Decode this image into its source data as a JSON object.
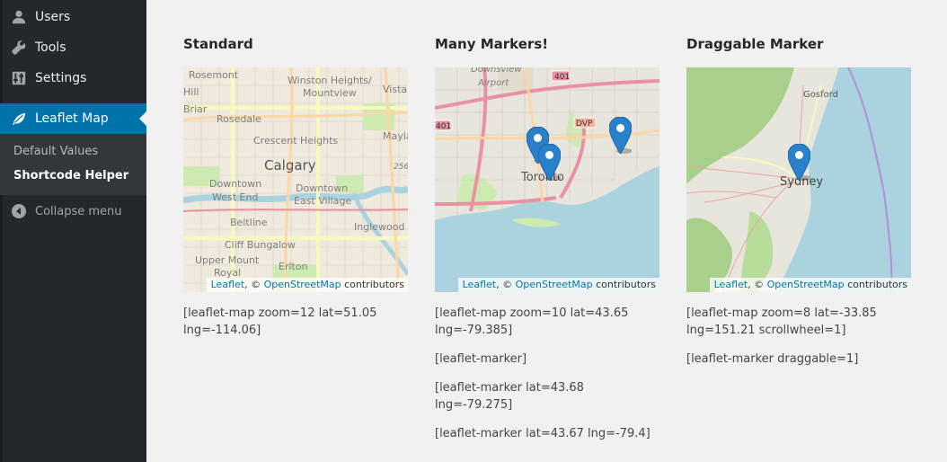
{
  "sidebar": {
    "items": [
      {
        "label": "Users",
        "icon": "users-icon"
      },
      {
        "label": "Tools",
        "icon": "wrench-icon"
      },
      {
        "label": "Settings",
        "icon": "settings-sliders-icon"
      },
      {
        "label": "Leaflet Map",
        "icon": "leaf-icon",
        "active": true
      }
    ],
    "submenu": [
      {
        "label": "Default Values"
      },
      {
        "label": "Shortcode Helper",
        "current": true
      }
    ],
    "collapse_label": "Collapse menu",
    "colors": {
      "background": "#23282d",
      "active": "#0073aa",
      "submenu": "#32373c"
    }
  },
  "attribution": {
    "leaflet": "Leaflet",
    "sep": ", © ",
    "osm": "OpenStreetMap",
    "suffix": " contributors"
  },
  "maps": [
    {
      "title": "Standard",
      "labels": [
        "Rosemont",
        "Winston Heights/",
        "Mountview",
        "Vista",
        "Hill",
        "Briar",
        "Rosedale",
        "Mayla",
        "Crescent Heights",
        "Calgary",
        "Downtown",
        "West End",
        "Downtown",
        "East Village",
        "Beltline",
        "Inglewood",
        "Cliff Bungalow",
        "Upper Mount",
        "Royal",
        "Erlton",
        "256"
      ],
      "codes": [
        "[leaflet-map zoom=12 lat=51.05 lng=-114.06]"
      ]
    },
    {
      "title": "Many Markers!",
      "labels": [
        "Downsview",
        "Airport",
        "401",
        "401",
        "DVP",
        "Toronto"
      ],
      "marker_count": 3,
      "codes": [
        "[leaflet-map zoom=10 lat=43.65 lng=-79.385]",
        "[leaflet-marker]",
        "[leaflet-marker lat=43.68 lng=-79.275]",
        "[leaflet-marker lat=43.67 lng=-79.4]"
      ]
    },
    {
      "title": "Draggable Marker",
      "labels": [
        "Gosford",
        "Sydney"
      ],
      "marker_count": 1,
      "codes": [
        "[leaflet-map zoom=8 lat=-33.85 lng=151.21 scrollwheel=1]",
        "[leaflet-marker draggable=1]"
      ]
    }
  ]
}
